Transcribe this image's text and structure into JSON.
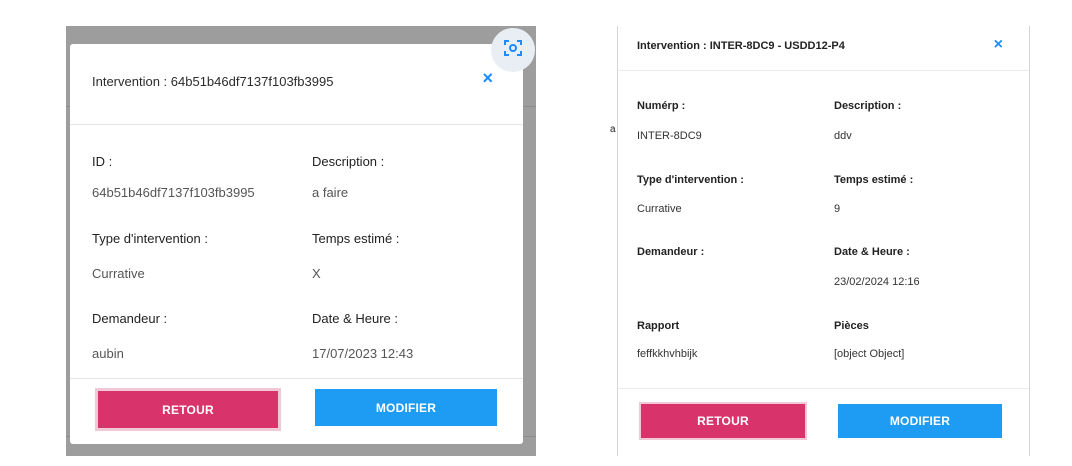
{
  "left": {
    "title": "Intervention : 64b51b46df7137f103fb3995",
    "close_glyph": "×",
    "labels": {
      "id": "ID :",
      "description": "Description :",
      "type": "Type d'intervention :",
      "temps": "Temps estimé :",
      "demandeur": "Demandeur :",
      "date": "Date & Heure :"
    },
    "values": {
      "id": "64b51b46df7137f103fb3995",
      "description": "a faire",
      "type": "Currative",
      "temps": "X",
      "demandeur": "aubin",
      "date": "17/07/2023 12:43"
    },
    "buttons": {
      "retour": "RETOUR",
      "modifier": "MODIFIER"
    }
  },
  "right": {
    "title": "Intervention : INTER-8DC9 - USDD12-P4",
    "close_glyph": "×",
    "labels": {
      "numero": "Numérp :",
      "description": "Description :",
      "type": "Type d'intervention :",
      "temps": "Temps estimé :",
      "demandeur": "Demandeur :",
      "date": "Date & Heure :",
      "rapport": "Rapport",
      "pieces": "Pièces"
    },
    "values": {
      "numero": "INTER-8DC9",
      "description": "ddv",
      "type": "Currative",
      "temps": "9",
      "date": "23/02/2024 12:16",
      "rapport": "feffkkhvhbijk",
      "pieces": "[object Object]"
    },
    "buttons": {
      "retour": "RETOUR",
      "modifier": "MODIFIER"
    }
  },
  "colors": {
    "retour": "#d8336a",
    "modifier": "#1e9cf3",
    "close": "#1a8cff"
  },
  "icons": {
    "fab": "screenshot-scan-icon",
    "close": "close-icon"
  }
}
